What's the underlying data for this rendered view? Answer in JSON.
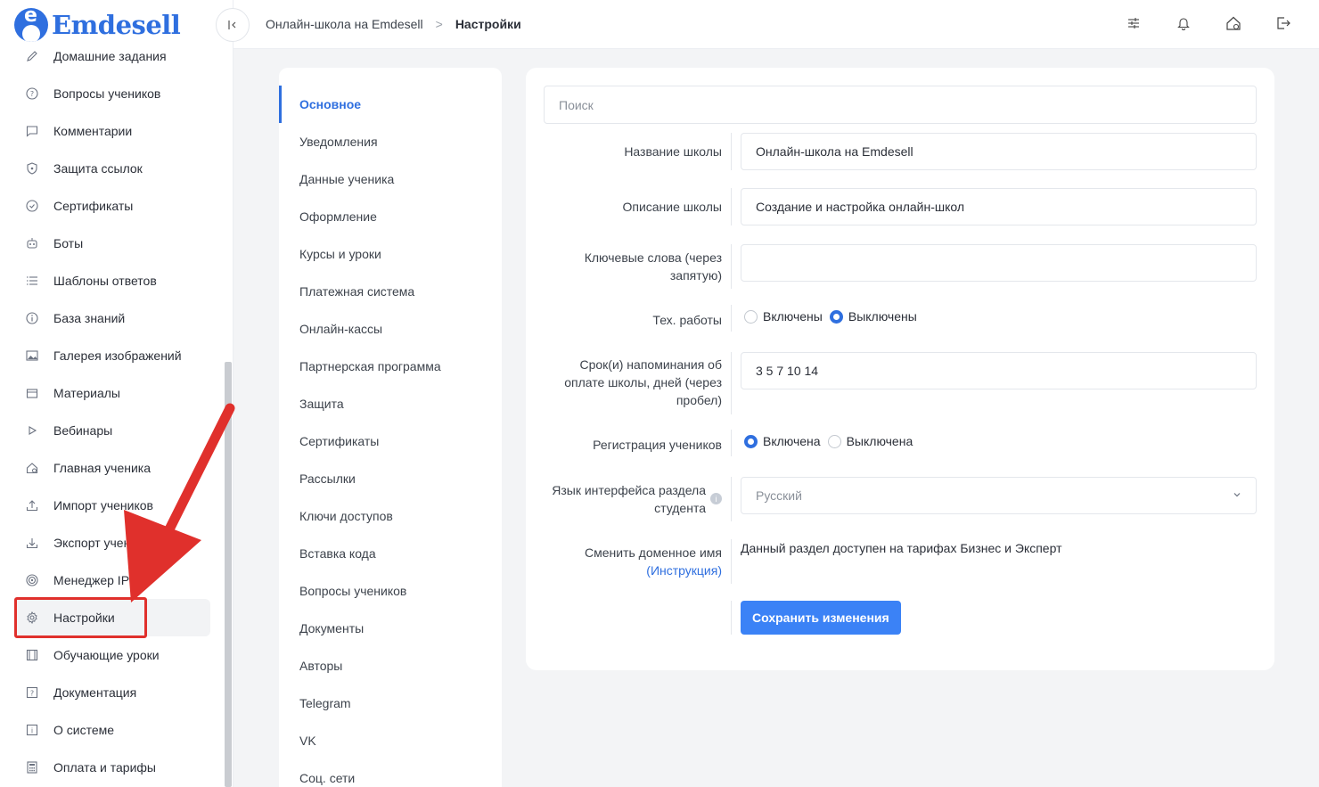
{
  "brand": {
    "name": "Emdesell",
    "logo_letter": "e",
    "color": "#2f6fdf"
  },
  "sidebar": {
    "items": [
      {
        "label": "Домашние задания",
        "icon": "pencil-icon"
      },
      {
        "label": "Вопросы учеников",
        "icon": "question-circle-icon"
      },
      {
        "label": "Комментарии",
        "icon": "comment-icon"
      },
      {
        "label": "Защита ссылок",
        "icon": "shield-icon"
      },
      {
        "label": "Сертификаты",
        "icon": "check-circle-icon"
      },
      {
        "label": "Боты",
        "icon": "robot-icon"
      },
      {
        "label": "Шаблоны ответов",
        "icon": "list-icon"
      },
      {
        "label": "База знаний",
        "icon": "info-circle-icon"
      },
      {
        "label": "Галерея изображений",
        "icon": "image-icon"
      },
      {
        "label": "Материалы",
        "icon": "box-icon"
      },
      {
        "label": "Вебинары",
        "icon": "play-icon"
      },
      {
        "label": "Главная ученика",
        "icon": "home-gear-icon"
      },
      {
        "label": "Импорт учеников",
        "icon": "upload-icon"
      },
      {
        "label": "Экспорт учеников",
        "icon": "download-icon"
      },
      {
        "label": "Менеджер IP",
        "icon": "target-icon"
      },
      {
        "label": "Настройки",
        "icon": "gear-icon",
        "active": true
      },
      {
        "label": "Обучающие уроки",
        "icon": "film-icon"
      },
      {
        "label": "Документация",
        "icon": "question-square-icon"
      },
      {
        "label": "О системе",
        "icon": "info-square-icon"
      },
      {
        "label": "Оплата и тарифы",
        "icon": "calculator-icon"
      }
    ]
  },
  "topbar": {
    "breadcrumb": {
      "parent": "Онлайн-школа на Emdesell",
      "separator": ">",
      "current": "Настройки"
    },
    "icons": [
      "sliders-icon",
      "bell-icon",
      "home-gear-icon",
      "logout-icon"
    ]
  },
  "settings_nav": {
    "items": [
      {
        "label": "Основное",
        "active": true
      },
      {
        "label": "Уведомления"
      },
      {
        "label": "Данные ученика"
      },
      {
        "label": "Оформление"
      },
      {
        "label": "Курсы и уроки"
      },
      {
        "label": "Платежная система"
      },
      {
        "label": "Онлайн-кассы"
      },
      {
        "label": "Партнерская программа"
      },
      {
        "label": "Защита"
      },
      {
        "label": "Сертификаты"
      },
      {
        "label": "Рассылки"
      },
      {
        "label": "Ключи доступов"
      },
      {
        "label": "Вставка кода"
      },
      {
        "label": "Вопросы учеников"
      },
      {
        "label": "Документы"
      },
      {
        "label": "Авторы"
      },
      {
        "label": "Telegram"
      },
      {
        "label": "VK"
      },
      {
        "label": "Соц. сети"
      }
    ]
  },
  "form": {
    "search_placeholder": "Поиск",
    "school_name": {
      "label": "Название школы",
      "value": "Онлайн-школа на Emdesell"
    },
    "school_description": {
      "label": "Описание школы",
      "value": "Создание и настройка онлайн-школ"
    },
    "keywords": {
      "label_line1": "Ключевые слова (через",
      "label_line2": "запятую)",
      "value": ""
    },
    "maintenance": {
      "label": "Тех. работы",
      "option_on": "Включены",
      "option_off": "Выключены",
      "selected": "off"
    },
    "reminders": {
      "label_line1": "Срок(и) напоминания об",
      "label_line2": "оплате школы, дней (через",
      "label_line3": "пробел)",
      "value": "3 5 7 10 14"
    },
    "registration": {
      "label": "Регистрация учеников",
      "option_on": "Включена",
      "option_off": "Выключена",
      "selected": "on"
    },
    "language": {
      "label_line1": "Язык интерфейса раздела",
      "label_line2": "студента",
      "value": "Русский",
      "info_icon": "info-icon"
    },
    "domain": {
      "label_line1": "Сменить доменное имя",
      "link": "(Инструкция)",
      "note": "Данный раздел доступен на тарифах Бизнес и Эксперт"
    },
    "save_label": "Сохранить изменения"
  },
  "colors": {
    "accent": "#2f6fdf",
    "button": "#3b82f6",
    "annotation_red": "#e0302c"
  }
}
